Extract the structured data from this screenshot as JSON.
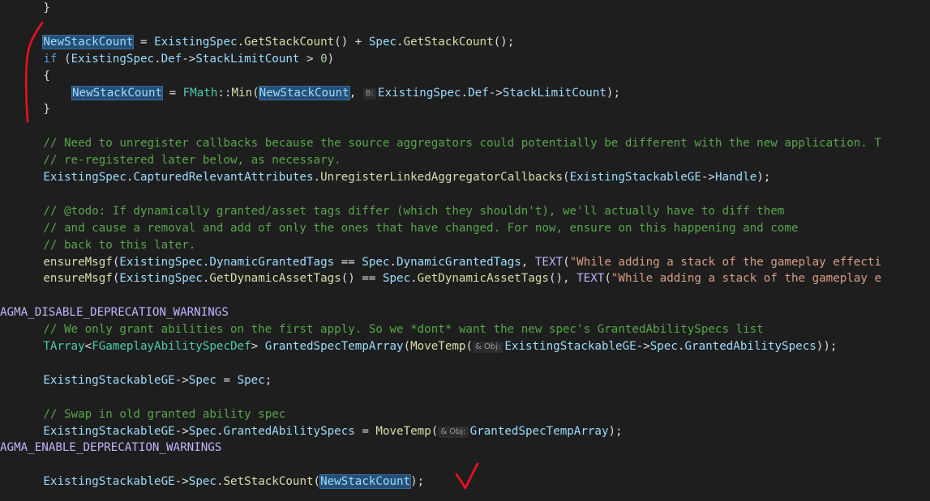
{
  "editor": {
    "font_note": "",
    "lines": [
      {
        "indent": 6,
        "tokens": [
          {
            "t": "pl",
            "v": "}"
          }
        ]
      },
      {
        "indent": 0,
        "tokens": []
      },
      {
        "indent": 6,
        "tokens": [
          {
            "t": "id",
            "v": "NewStackCount",
            "hl": true
          },
          {
            "t": "pl",
            "v": " = "
          },
          {
            "t": "id",
            "v": "ExistingSpec"
          },
          {
            "t": "pl",
            "v": "."
          },
          {
            "t": "fn",
            "v": "GetStackCount"
          },
          {
            "t": "pl",
            "v": "() + "
          },
          {
            "t": "id",
            "v": "Spec"
          },
          {
            "t": "pl",
            "v": "."
          },
          {
            "t": "fn",
            "v": "GetStackCount"
          },
          {
            "t": "pl",
            "v": "();"
          }
        ]
      },
      {
        "indent": 6,
        "tokens": [
          {
            "t": "kw",
            "v": "if"
          },
          {
            "t": "pl",
            "v": " ("
          },
          {
            "t": "id",
            "v": "ExistingSpec"
          },
          {
            "t": "pl",
            "v": "."
          },
          {
            "t": "id",
            "v": "Def"
          },
          {
            "t": "pl",
            "v": "->"
          },
          {
            "t": "id",
            "v": "StackLimitCount"
          },
          {
            "t": "pl",
            "v": " > "
          },
          {
            "t": "nu",
            "v": "0"
          },
          {
            "t": "pl",
            "v": ")"
          }
        ]
      },
      {
        "indent": 6,
        "tokens": [
          {
            "t": "pl",
            "v": "{"
          }
        ]
      },
      {
        "indent": 10,
        "tokens": [
          {
            "t": "id",
            "v": "NewStackCount",
            "hl": true
          },
          {
            "t": "pl",
            "v": " = "
          },
          {
            "t": "ty",
            "v": "FMath"
          },
          {
            "t": "pl",
            "v": "::"
          },
          {
            "t": "fn",
            "v": "Min"
          },
          {
            "t": "pl",
            "v": "("
          },
          {
            "t": "id",
            "v": "NewStackCount",
            "hl": true
          },
          {
            "t": "pl",
            "v": ", "
          },
          {
            "t": "hint",
            "v": "B:"
          },
          {
            "t": "id",
            "v": "ExistingSpec"
          },
          {
            "t": "pl",
            "v": "."
          },
          {
            "t": "id",
            "v": "Def"
          },
          {
            "t": "pl",
            "v": "->"
          },
          {
            "t": "id",
            "v": "StackLimitCount"
          },
          {
            "t": "pl",
            "v": ");"
          }
        ]
      },
      {
        "indent": 6,
        "tokens": [
          {
            "t": "pl",
            "v": "}"
          }
        ]
      },
      {
        "indent": 0,
        "tokens": []
      },
      {
        "indent": 6,
        "tokens": [
          {
            "t": "cm",
            "v": "// Need to unregister callbacks because the source aggregators could potentially be different with the new application. T"
          }
        ]
      },
      {
        "indent": 6,
        "tokens": [
          {
            "t": "cm",
            "v": "// re-registered later below, as necessary."
          }
        ]
      },
      {
        "indent": 6,
        "tokens": [
          {
            "t": "id",
            "v": "ExistingSpec"
          },
          {
            "t": "pl",
            "v": "."
          },
          {
            "t": "id",
            "v": "CapturedRelevantAttributes"
          },
          {
            "t": "pl",
            "v": "."
          },
          {
            "t": "fn",
            "v": "UnregisterLinkedAggregatorCallbacks"
          },
          {
            "t": "pl",
            "v": "("
          },
          {
            "t": "id",
            "v": "ExistingStackableGE"
          },
          {
            "t": "pl",
            "v": "->"
          },
          {
            "t": "id",
            "v": "Handle"
          },
          {
            "t": "pl",
            "v": ");"
          }
        ]
      },
      {
        "indent": 0,
        "tokens": []
      },
      {
        "indent": 6,
        "tokens": [
          {
            "t": "cm",
            "v": "// @todo: If dynamically granted/asset tags differ (which they shouldn't), we'll actually have to diff them"
          }
        ]
      },
      {
        "indent": 6,
        "tokens": [
          {
            "t": "cm",
            "v": "// and cause a removal and add of only the ones that have changed. For now, ensure on this happening and come"
          }
        ]
      },
      {
        "indent": 6,
        "tokens": [
          {
            "t": "cm",
            "v": "// back to this later."
          }
        ]
      },
      {
        "indent": 6,
        "tokens": [
          {
            "t": "fn",
            "v": "ensureMsgf"
          },
          {
            "t": "pl",
            "v": "("
          },
          {
            "t": "id",
            "v": "ExistingSpec"
          },
          {
            "t": "pl",
            "v": "."
          },
          {
            "t": "id",
            "v": "DynamicGrantedTags"
          },
          {
            "t": "pl",
            "v": " == "
          },
          {
            "t": "id",
            "v": "Spec"
          },
          {
            "t": "pl",
            "v": "."
          },
          {
            "t": "id",
            "v": "DynamicGrantedTags"
          },
          {
            "t": "pl",
            "v": ", "
          },
          {
            "t": "mc",
            "v": "TEXT"
          },
          {
            "t": "pl",
            "v": "("
          },
          {
            "t": "st",
            "v": "\"While adding a stack of the gameplay effecti"
          }
        ]
      },
      {
        "indent": 6,
        "tokens": [
          {
            "t": "fn",
            "v": "ensureMsgf"
          },
          {
            "t": "pl",
            "v": "("
          },
          {
            "t": "id",
            "v": "ExistingSpec"
          },
          {
            "t": "pl",
            "v": "."
          },
          {
            "t": "fn",
            "v": "GetDynamicAssetTags"
          },
          {
            "t": "pl",
            "v": "() == "
          },
          {
            "t": "id",
            "v": "Spec"
          },
          {
            "t": "pl",
            "v": "."
          },
          {
            "t": "fn",
            "v": "GetDynamicAssetTags"
          },
          {
            "t": "pl",
            "v": "(), "
          },
          {
            "t": "mc",
            "v": "TEXT"
          },
          {
            "t": "pl",
            "v": "("
          },
          {
            "t": "st",
            "v": "\"While adding a stack of the gameplay e"
          }
        ]
      },
      {
        "indent": 0,
        "tokens": []
      },
      {
        "indent": 0,
        "tokens": [
          {
            "t": "mc",
            "v": "AGMA_DISABLE_DEPRECATION_WARNINGS"
          }
        ]
      },
      {
        "indent": 6,
        "tokens": [
          {
            "t": "cm",
            "v": "// We only grant abilities on the first apply. So we *dont* want the new spec's GrantedAbilitySpecs list"
          }
        ]
      },
      {
        "indent": 6,
        "tokens": [
          {
            "t": "ty",
            "v": "TArray"
          },
          {
            "t": "pl",
            "v": "<"
          },
          {
            "t": "ty",
            "v": "FGameplayAbilitySpecDef"
          },
          {
            "t": "pl",
            "v": "> "
          },
          {
            "t": "id",
            "v": "GrantedSpecTempArray"
          },
          {
            "t": "pl",
            "v": "("
          },
          {
            "t": "fn",
            "v": "MoveTemp"
          },
          {
            "t": "pl",
            "v": "("
          },
          {
            "t": "hint",
            "v": "& Obj:"
          },
          {
            "t": "id",
            "v": "ExistingStackableGE"
          },
          {
            "t": "pl",
            "v": "->"
          },
          {
            "t": "id",
            "v": "Spec"
          },
          {
            "t": "pl",
            "v": "."
          },
          {
            "t": "id",
            "v": "GrantedAbilitySpecs"
          },
          {
            "t": "pl",
            "v": "));"
          }
        ]
      },
      {
        "indent": 0,
        "tokens": []
      },
      {
        "indent": 6,
        "tokens": [
          {
            "t": "id",
            "v": "ExistingStackableGE"
          },
          {
            "t": "pl",
            "v": "->"
          },
          {
            "t": "id",
            "v": "Spec"
          },
          {
            "t": "pl",
            "v": " = "
          },
          {
            "t": "id",
            "v": "Spec"
          },
          {
            "t": "pl",
            "v": ";"
          }
        ]
      },
      {
        "indent": 0,
        "tokens": []
      },
      {
        "indent": 6,
        "tokens": [
          {
            "t": "cm",
            "v": "// Swap in old granted ability spec"
          }
        ]
      },
      {
        "indent": 6,
        "tokens": [
          {
            "t": "id",
            "v": "ExistingStackableGE"
          },
          {
            "t": "pl",
            "v": "->"
          },
          {
            "t": "id",
            "v": "Spec"
          },
          {
            "t": "pl",
            "v": "."
          },
          {
            "t": "id",
            "v": "GrantedAbilitySpecs"
          },
          {
            "t": "pl",
            "v": " = "
          },
          {
            "t": "fn",
            "v": "MoveTemp"
          },
          {
            "t": "pl",
            "v": "("
          },
          {
            "t": "hint",
            "v": "& Obj:"
          },
          {
            "t": "id",
            "v": "GrantedSpecTempArray"
          },
          {
            "t": "pl",
            "v": ");"
          }
        ]
      },
      {
        "indent": 0,
        "tokens": [
          {
            "t": "mc",
            "v": "AGMA_ENABLE_DEPRECATION_WARNINGS"
          }
        ]
      },
      {
        "indent": 0,
        "tokens": []
      },
      {
        "indent": 6,
        "tokens": [
          {
            "t": "id",
            "v": "ExistingStackableGE"
          },
          {
            "t": "pl",
            "v": "->"
          },
          {
            "t": "id",
            "v": "Spec"
          },
          {
            "t": "pl",
            "v": "."
          },
          {
            "t": "fn",
            "v": "SetStackCount"
          },
          {
            "t": "pl",
            "v": "("
          },
          {
            "t": "id",
            "v": "NewStackCount",
            "hl": true
          },
          {
            "t": "pl",
            "v": ");"
          }
        ]
      }
    ]
  },
  "annotations": {
    "bracket": {
      "kind": "hand-drawn-bracket",
      "color": "#e81123"
    },
    "checkmark": {
      "kind": "hand-drawn-checkmark",
      "color": "#e81123"
    }
  },
  "colors": {
    "background": "#1e1e1e",
    "identifier": "#9cdcfe",
    "type": "#4ec9b0",
    "function": "#dcdcaa",
    "keyword": "#569cd6",
    "comment": "#57a64a",
    "string": "#d69d85",
    "macro": "#beb7ff",
    "selection": "#264f78"
  }
}
